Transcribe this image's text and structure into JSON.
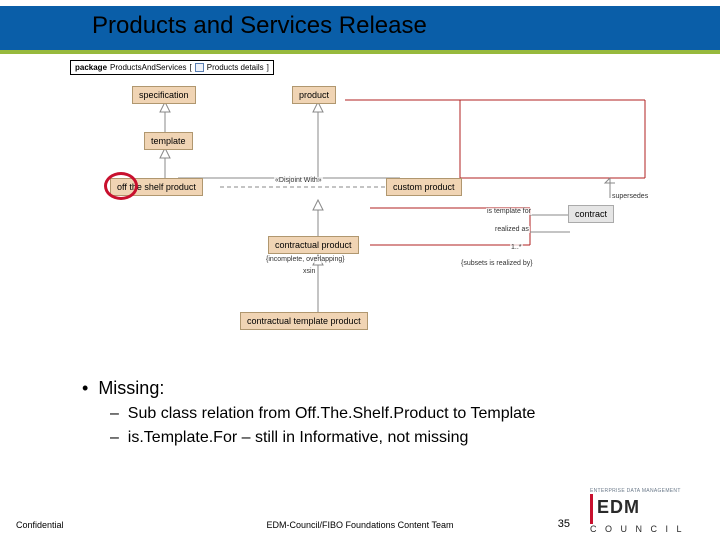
{
  "title": "Products and Services Release",
  "package_tab": {
    "prefix": "package",
    "name": "ProductsAndServices",
    "detail": "Products details"
  },
  "nodes": {
    "specification": "specification",
    "template": "template",
    "off_the_shelf": "off the shelf product",
    "product": "product",
    "custom_product": "custom product",
    "contractual_product": "contractual product",
    "contractual_template_product": "contractual template product",
    "contract": "contract"
  },
  "edge_labels": {
    "disjoint": "«Disjoint With»",
    "constraint": "{incomplete, overlapping}",
    "is_template_for": "is template for",
    "realized_as": "realized as",
    "supersedes": "supersedes",
    "subsets": "{subsets is realized by}",
    "card1": "1..*",
    "xsin": "xsin"
  },
  "bullets": {
    "heading": "Missing:",
    "items": [
      "Sub class relation from Off.The.Shelf.Product to Template",
      "is.Template.For – still in Informative, not missing"
    ]
  },
  "footer": {
    "confidential": "Confidential",
    "center": "EDM-Council/FIBO Foundations Content Team",
    "page": "35"
  },
  "logo": {
    "top": "ENTERPRISE DATA MANAGEMENT",
    "main": "EDM",
    "bottom": "C O U N C I L"
  }
}
